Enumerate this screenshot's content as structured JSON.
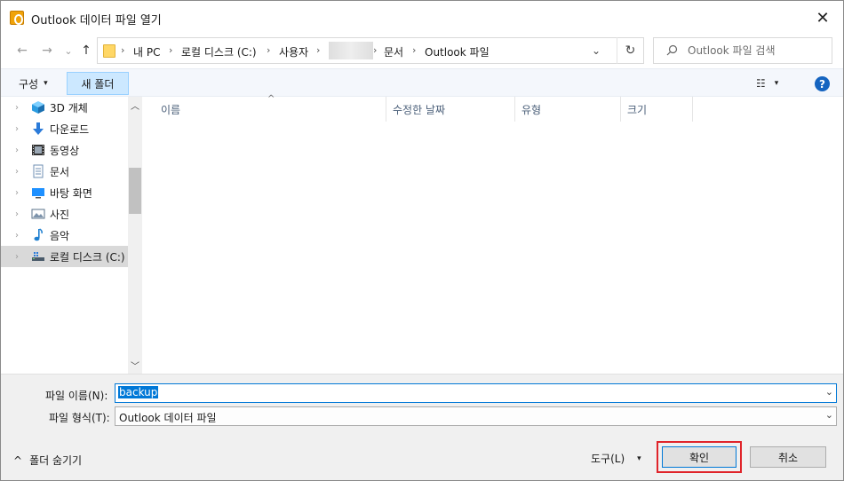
{
  "window": {
    "title": "Outlook 데이터 파일 열기",
    "close_glyph": "✕"
  },
  "nav": {
    "back_glyph": "←",
    "forward_glyph": "→",
    "recent_glyph": "⌄",
    "up_glyph": "↑",
    "breadcrumbs": [
      "내 PC",
      "로컬 디스크 (C:)",
      "사용자",
      "문서",
      "Outlook 파일"
    ],
    "crumb_sep": "›",
    "dropdown_glyph": "⌄",
    "refresh_glyph": "↻"
  },
  "search": {
    "placeholder": "Outlook 파일 검색",
    "icon": "search-icon"
  },
  "toolbar": {
    "organize_label": "구성",
    "organize_caret": "▾",
    "new_folder_label": "새 폴더",
    "view_glyph": "☷",
    "view_caret": "▾",
    "help_label": "?"
  },
  "tree": [
    {
      "label": "3D 개체",
      "icon": "cube-icon",
      "color": "#2b9be0"
    },
    {
      "label": "다운로드",
      "icon": "download-arrow-icon",
      "color": "#2b7bd9"
    },
    {
      "label": "동영상",
      "icon": "film-icon",
      "color": "#333333"
    },
    {
      "label": "문서",
      "icon": "document-icon",
      "color": "#6f8fb3"
    },
    {
      "label": "바탕 화면",
      "icon": "desktop-icon",
      "color": "#1e90ff"
    },
    {
      "label": "사진",
      "icon": "picture-icon",
      "color": "#5a7089"
    },
    {
      "label": "음악",
      "icon": "music-note-icon",
      "color": "#1e7fd0"
    },
    {
      "label": "로컬 디스크 (C:)",
      "icon": "drive-icon",
      "color": "#4a5a6a",
      "selected": true
    }
  ],
  "tree_chevron": "›",
  "columns": [
    "이름",
    "수정한 날짜",
    "유형",
    "크기"
  ],
  "sort_glyph": "^",
  "scroll": {
    "up_glyph": "︿",
    "down_glyph": "﹀"
  },
  "bottom": {
    "filename_label": "파일 이름(N):",
    "filename_value": "backup",
    "filetype_label": "파일 형식(T):",
    "filetype_value": "Outlook 데이터 파일",
    "drop_glyph": "⌄",
    "hide_folders_glyph": "^",
    "hide_folders_label": "폴더 숨기기",
    "tools_label": "도구(L)",
    "tools_caret": "▾",
    "ok_label": "확인",
    "cancel_label": "취소"
  },
  "colors": {
    "accent": "#0078d7",
    "highlight_outline": "#e0242a",
    "new_folder_bg": "#cce8ff"
  }
}
